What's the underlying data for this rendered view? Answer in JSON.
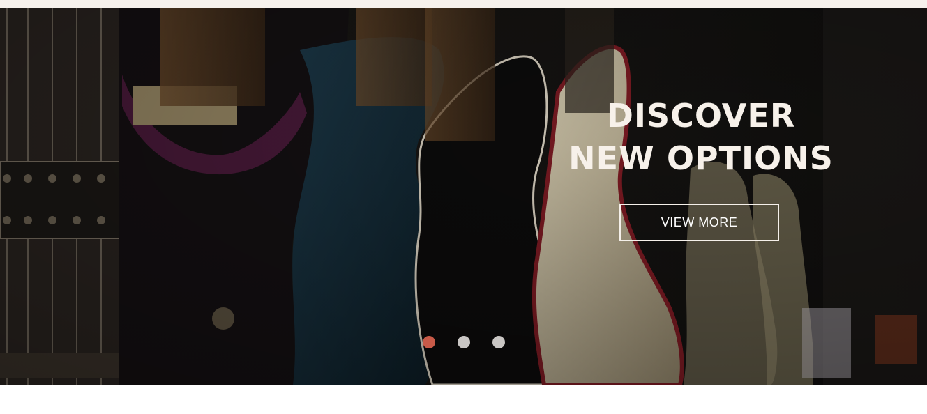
{
  "hero": {
    "headline_line1": "DISCOVER",
    "headline_line2": "NEW OPTIONS",
    "button_label": "VIEW MORE",
    "background_image": "electric-guitars-on-wall",
    "slides": 3,
    "active_slide": 1
  },
  "colors": {
    "topbar": "#f6f1ec",
    "headline": "#f7f1ea",
    "active_dot": "#c85a48",
    "inactive_dot": "#c9c6c4"
  }
}
